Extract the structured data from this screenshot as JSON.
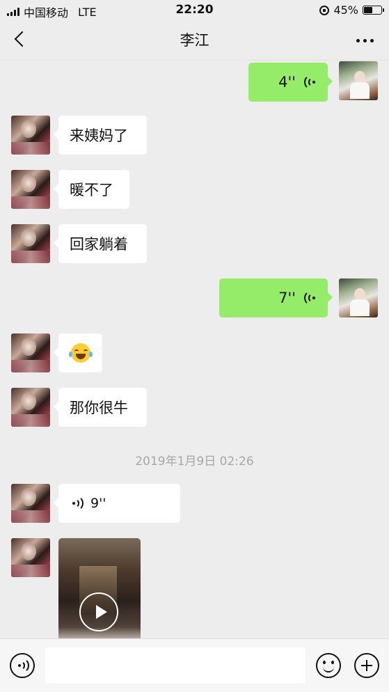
{
  "status_bar": {
    "carrier": "中国移动",
    "network": "LTE",
    "time": "22:20",
    "battery": "45%",
    "battery_level": 0.45,
    "icons": [
      "signal-icon",
      "orientation-lock-icon",
      "battery-icon"
    ]
  },
  "header": {
    "title": "李江",
    "back_icon": "chevron-left-icon",
    "more_icon": "more-dots-icon"
  },
  "messages": [
    {
      "from": "me",
      "type": "voice",
      "duration": "4''"
    },
    {
      "from": "other",
      "type": "text",
      "text": "来姨妈了"
    },
    {
      "from": "other",
      "type": "text",
      "text": "暖不了"
    },
    {
      "from": "other",
      "type": "text",
      "text": "回家躺着"
    },
    {
      "from": "me",
      "type": "voice",
      "duration": "7''"
    },
    {
      "from": "other",
      "type": "emoji",
      "emoji": "tears-of-joy-emoji"
    },
    {
      "from": "other",
      "type": "text",
      "text": "那你很牛"
    },
    {
      "type": "timestamp",
      "text": "2019年1月9日 02:26"
    },
    {
      "from": "other",
      "type": "voice",
      "duration": "9''"
    },
    {
      "from": "other",
      "type": "video",
      "icon": "play-icon"
    }
  ],
  "input_bar": {
    "value": "",
    "icons": [
      "voice-input-icon",
      "emoji-icon",
      "plus-icon"
    ]
  },
  "colors": {
    "background": "#ededed",
    "my_bubble": "#95ec69",
    "other_bubble": "#ffffff",
    "timestamp": "#a7a7a7"
  }
}
